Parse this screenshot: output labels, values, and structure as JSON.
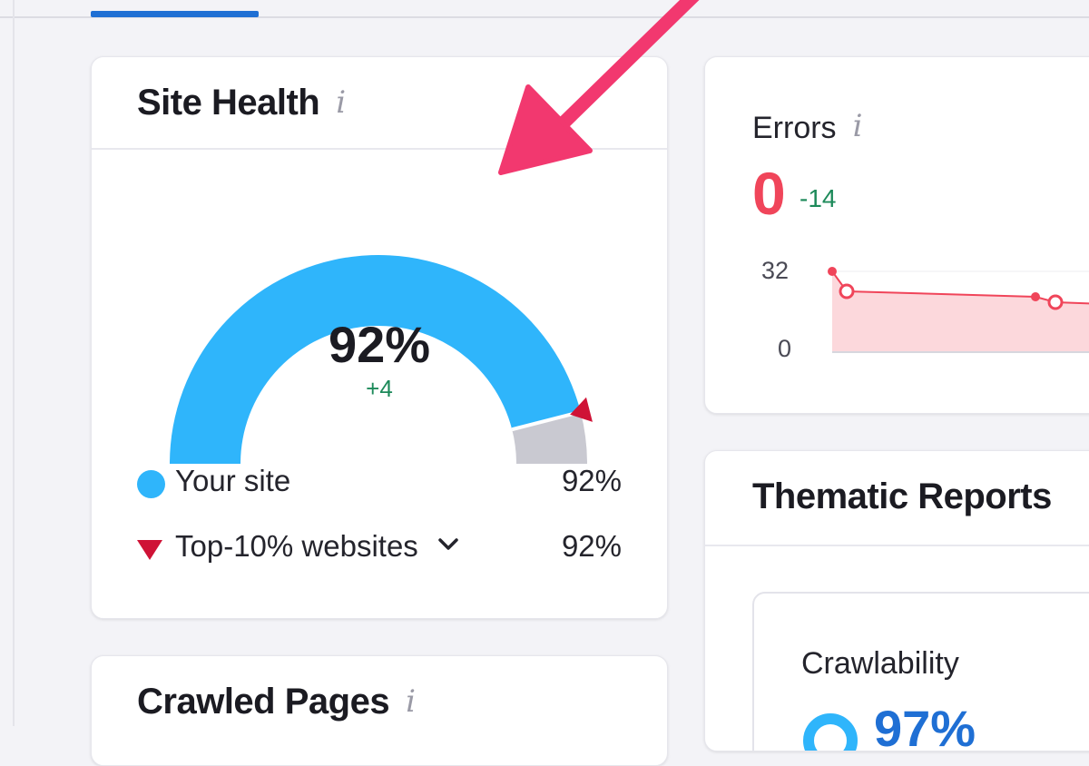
{
  "colors": {
    "accent_blue": "#2fb5fb",
    "tab_blue": "#1f6fd4",
    "error_red": "#f0455a",
    "top10_red": "#cf1236",
    "positive_green": "#1d8a5a",
    "annotation_pink": "#f2386f"
  },
  "site_health": {
    "title": "Site Health",
    "info_icon": "i",
    "score": "92%",
    "score_fraction": 0.92,
    "delta": "+4",
    "legend": [
      {
        "label": "Your site",
        "value": "92%",
        "marker": "circle"
      },
      {
        "label": "Top-10% websites",
        "value": "92%",
        "marker": "triangle",
        "icon": "chevron-down-icon"
      }
    ]
  },
  "errors": {
    "label": "Errors",
    "info_icon": "i",
    "value": "0",
    "delta": "-14",
    "axis_top": "32",
    "axis_bottom": "0"
  },
  "thematic_reports": {
    "title": "Thematic Reports",
    "crawlability": {
      "label": "Crawlability",
      "value": "97%"
    }
  },
  "crawled_pages": {
    "title": "Crawled Pages",
    "info_icon": "i"
  }
}
